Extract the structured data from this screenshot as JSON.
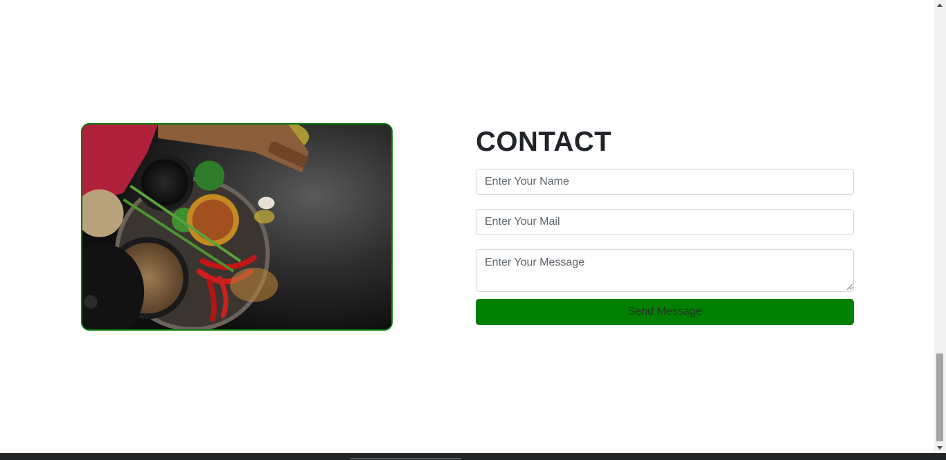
{
  "contact": {
    "title": "CONTACT",
    "image_alt": "spices-and-grains-image",
    "name_placeholder": "Enter Your Name",
    "mail_placeholder": "Enter Your Mail",
    "message_placeholder": "Enter Your Message",
    "send_label": "Send Message"
  },
  "colors": {
    "accent": "#008000",
    "image_border": "#0b7a0b",
    "footer": "#222426"
  },
  "scroll": {
    "position_fraction": 0.88
  }
}
